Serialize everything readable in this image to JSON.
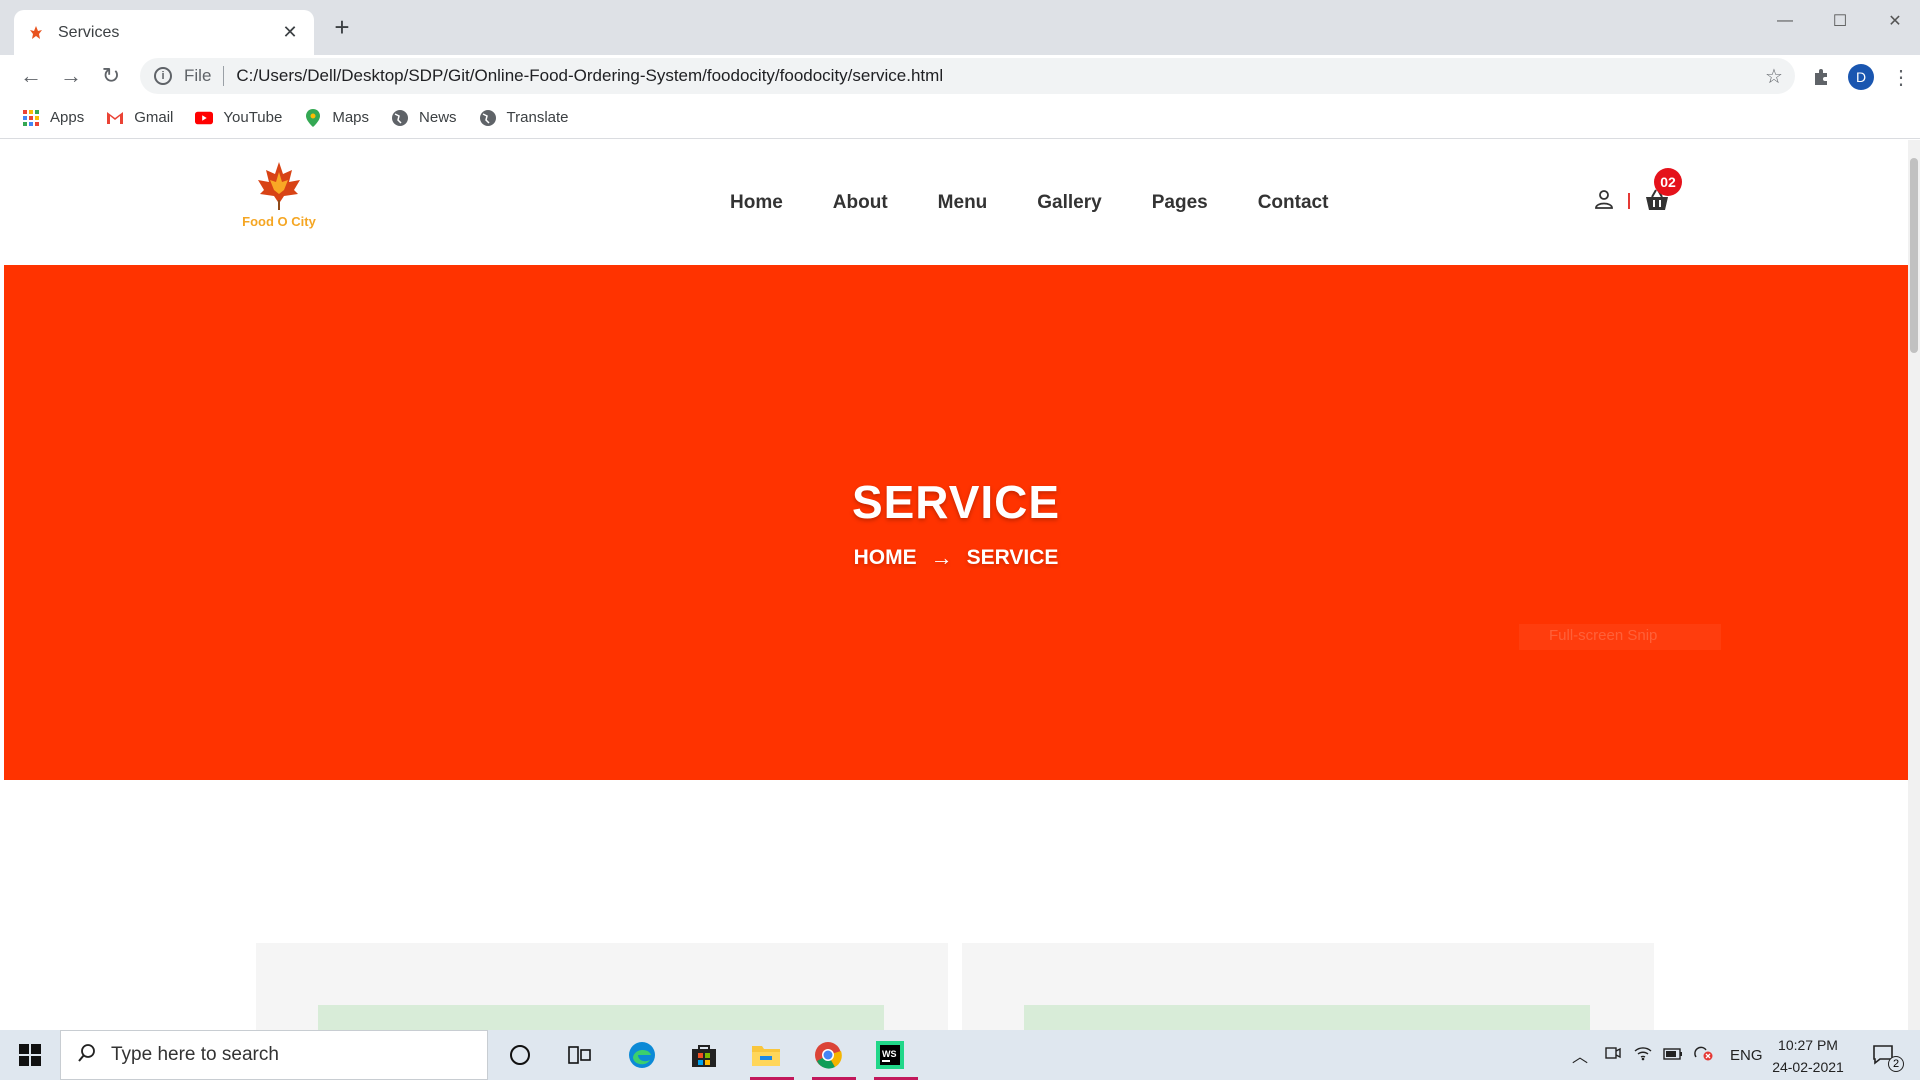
{
  "browser": {
    "tab_title": "Services",
    "address_prefix": "File",
    "url": "C:/Users/Dell/Desktop/SDP/Git/Online-Food-Ordering-System/foodocity/foodocity/service.html",
    "profile_initial": "D",
    "bookmarks": [
      {
        "label": "Apps",
        "icon": "apps-grid-icon"
      },
      {
        "label": "Gmail",
        "icon": "gmail-icon"
      },
      {
        "label": "YouTube",
        "icon": "youtube-icon"
      },
      {
        "label": "Maps",
        "icon": "maps-pin-icon"
      },
      {
        "label": "News",
        "icon": "globe-icon"
      },
      {
        "label": "Translate",
        "icon": "globe-icon"
      }
    ]
  },
  "site": {
    "logo_text": "Food O City",
    "nav": [
      "Home",
      "About",
      "Menu",
      "Gallery",
      "Pages",
      "Contact"
    ],
    "cart_count": "02",
    "accent_color": "#ff3300"
  },
  "hero": {
    "title": "SERVICE",
    "breadcrumb_home": "HOME",
    "breadcrumb_arrow": "→",
    "breadcrumb_current": "SERVICE",
    "snip_tooltip": "Full-screen Snip"
  },
  "taskbar": {
    "search_placeholder": "Type here to search",
    "language": "ENG",
    "time": "10:27 PM",
    "date": "24-02-2021",
    "notification_count": "2"
  }
}
